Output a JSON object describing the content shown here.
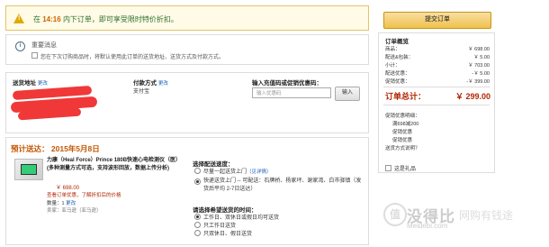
{
  "alert": {
    "icon": "warning-icon",
    "time": "14:16",
    "prefix": "在",
    "text": "内下订单，即可享受限时特价折扣。"
  },
  "notice": {
    "title": "重要消息",
    "text": "您在下次订购商品时，将默认使用此订单的送货地址、送货方式及付款方式。"
  },
  "address": {
    "label": "送货地址",
    "change": "更改"
  },
  "payment": {
    "label": "付款方式",
    "change": "更改",
    "value": "支付宝"
  },
  "coupon": {
    "label": "输入充值码或促销优惠码：",
    "placeholder": "输入优惠码",
    "button": "输入"
  },
  "delivery": {
    "date_label": "预计送达：",
    "date": "2015年5月8日",
    "product_name": "力康（Heal Force）Prince 180B快速心电检测仪（医）(多种测量方式可选，支持波形回放，数据上传分析)",
    "product_price": "￥ 698.00",
    "product_promo": "查看订单优惠，了解折扣后的价格",
    "qty_label": "数量：",
    "qty": "1",
    "qty_change": "更改",
    "seller": "卖家：亚马逊（亚马逊）",
    "speed_title": "选择配送速度：",
    "speed_options": [
      {
        "label": "尽量一起送货上门",
        "extra": "（见详情）",
        "selected": false
      },
      {
        "label": "快递送货上门 -- 可配送：石牌桥、杨家坪、谢家湾、白市驿镇（发货后平均 2-7日送达）",
        "selected": true
      }
    ],
    "time_title": "请选择希望送货的时间：",
    "time_options": [
      {
        "label": "工作日、双休日或假日均可送货",
        "selected": true
      },
      {
        "label": "只工作日送货",
        "selected": false
      },
      {
        "label": "只双休日、假日送货",
        "selected": false
      }
    ]
  },
  "sidebar": {
    "submit": "提交订单",
    "summary_title": "订单概览",
    "rows": [
      {
        "label": "商品：",
        "value": "￥ 698.00"
      },
      {
        "label": "配送&包装：",
        "value": "￥ 5.00"
      },
      {
        "label": "小计：",
        "value": "￥ 703.00"
      },
      {
        "label": "配送优惠：",
        "value": "-￥ 5.00"
      },
      {
        "label": "促销优惠：",
        "value": "-￥ 399.00"
      }
    ],
    "total_label": "订单总计：",
    "total_value": "￥ 299.00",
    "promo_title": "促销优惠明细：",
    "promo_items": [
      "满698减200",
      "促销优惠",
      "促销优惠"
    ],
    "promo_link": "送货方式说明？",
    "gift_label": "这是礼品"
  },
  "watermark": {
    "brand": "没得比",
    "site": "Meidebi.com",
    "slogan": "网购有钱途"
  }
}
